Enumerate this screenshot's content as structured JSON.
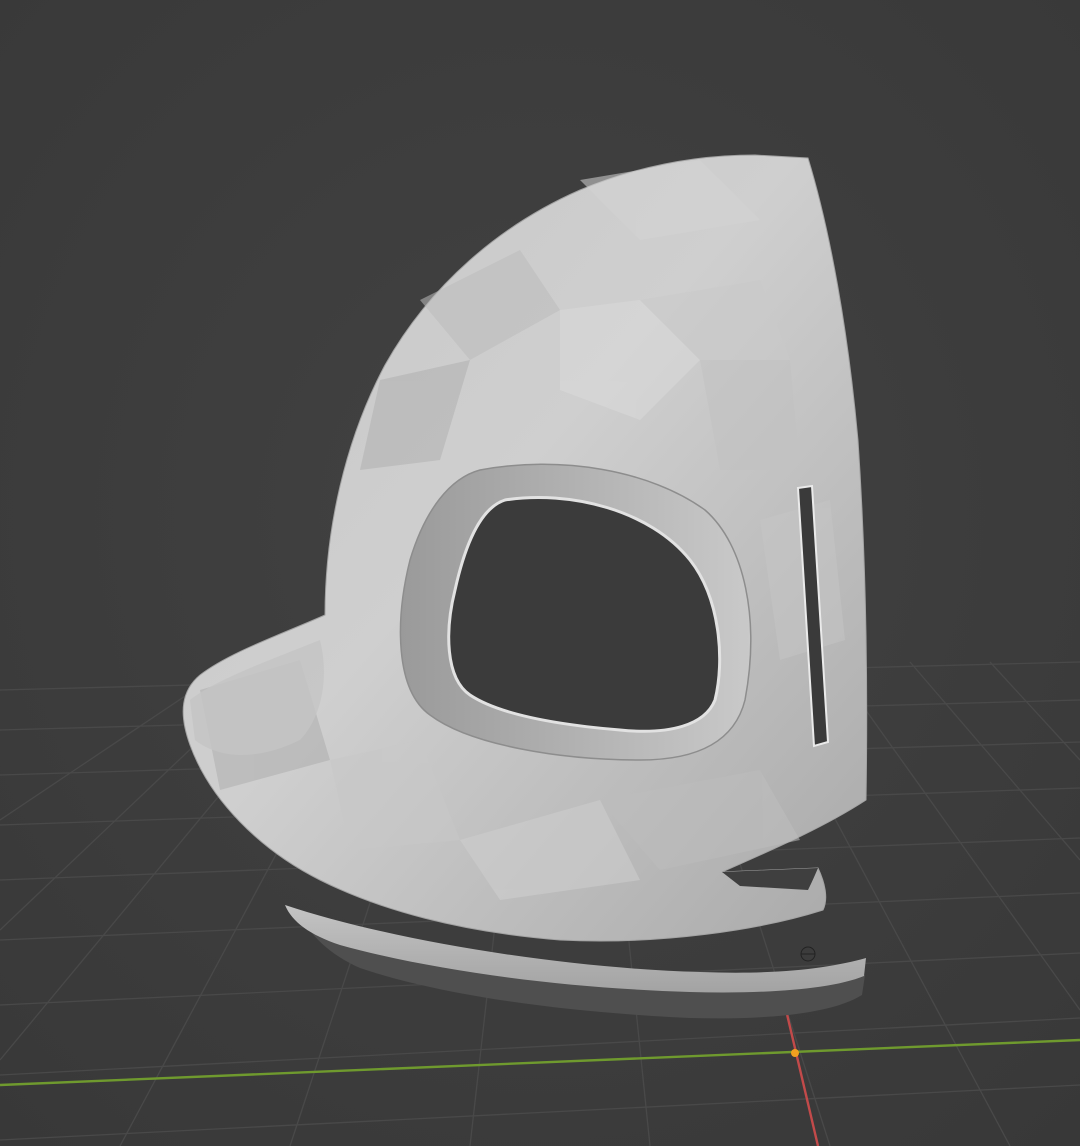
{
  "viewport": {
    "background": "#3d3d3d",
    "grid_color": "#4a4a4a",
    "x_axis_color": "#c24a4a",
    "y_axis_color": "#6f9a2e",
    "origin_color": "#f0a020"
  },
  "model": {
    "name": "mask",
    "face_color": "#b9b9b9",
    "highlight_color": "#d4d4d4",
    "shadow_color": "#8f8f8f",
    "base_color": "#545454"
  }
}
